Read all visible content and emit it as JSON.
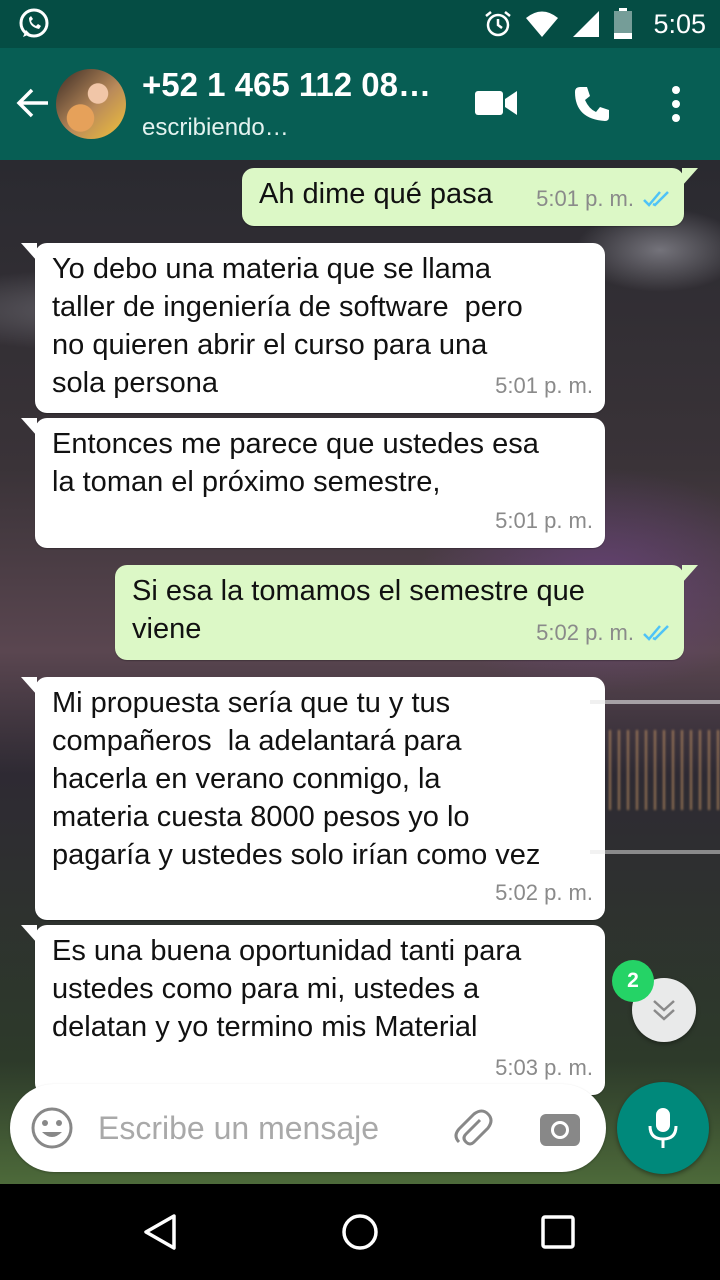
{
  "status_bar": {
    "time": "5:05"
  },
  "header": {
    "contact_name": "+52 1 465 112 08…",
    "contact_status": "escribiendo…"
  },
  "messages": [
    {
      "direction": "outgoing",
      "text": "Ah dime qué pasa",
      "time": "5:01 p. m.",
      "read": true
    },
    {
      "direction": "incoming",
      "text": "Yo debo una materia que se llama\ntaller de ingeniería de software  pero\nno quieren abrir el curso para una\nsola persona",
      "time": "5:01 p. m."
    },
    {
      "direction": "incoming",
      "text": "Entonces me parece que ustedes esa\nla toman el próximo semestre,",
      "time": "5:01 p. m."
    },
    {
      "direction": "outgoing",
      "text": "Si esa la tomamos el semestre que\nviene",
      "time": "5:02 p. m.",
      "read": true
    },
    {
      "direction": "incoming",
      "text": "Mi propuesta sería que tu y tus\ncompañeros  la adelantará para\nhacerla en verano conmigo, la\nmateria cuesta 8000 pesos yo lo\npagaría y ustedes solo irían como vez",
      "time": "5:02 p. m."
    },
    {
      "direction": "incoming",
      "text": "Es una buena oportunidad tanti para\nustedes como para mi, ustedes a\ndelatan y yo termino mis Material",
      "time": "5:03 p. m."
    }
  ],
  "scroll_fab": {
    "unread_count": "2"
  },
  "composer": {
    "placeholder": "Escribe un mensaje"
  },
  "colors": {
    "header": "#075e54",
    "status_bar": "#054d44",
    "outgoing_bubble": "#dcf8c6",
    "incoming_bubble": "#ffffff",
    "read_ticks": "#4fc3f7",
    "mic_fab": "#00897b",
    "unread_badge": "#25d366"
  },
  "icons": {
    "status_left": "whatsapp-icon",
    "status_right": [
      "alarm-icon",
      "wifi-icon",
      "signal-icon",
      "battery-icon"
    ],
    "header": [
      "back-arrow-icon",
      "video-call-icon",
      "phone-icon",
      "more-vert-icon"
    ],
    "composer": [
      "emoji-icon",
      "attach-icon",
      "camera-icon",
      "mic-icon"
    ],
    "nav": [
      "nav-back-icon",
      "nav-home-icon",
      "nav-recents-icon"
    ]
  }
}
